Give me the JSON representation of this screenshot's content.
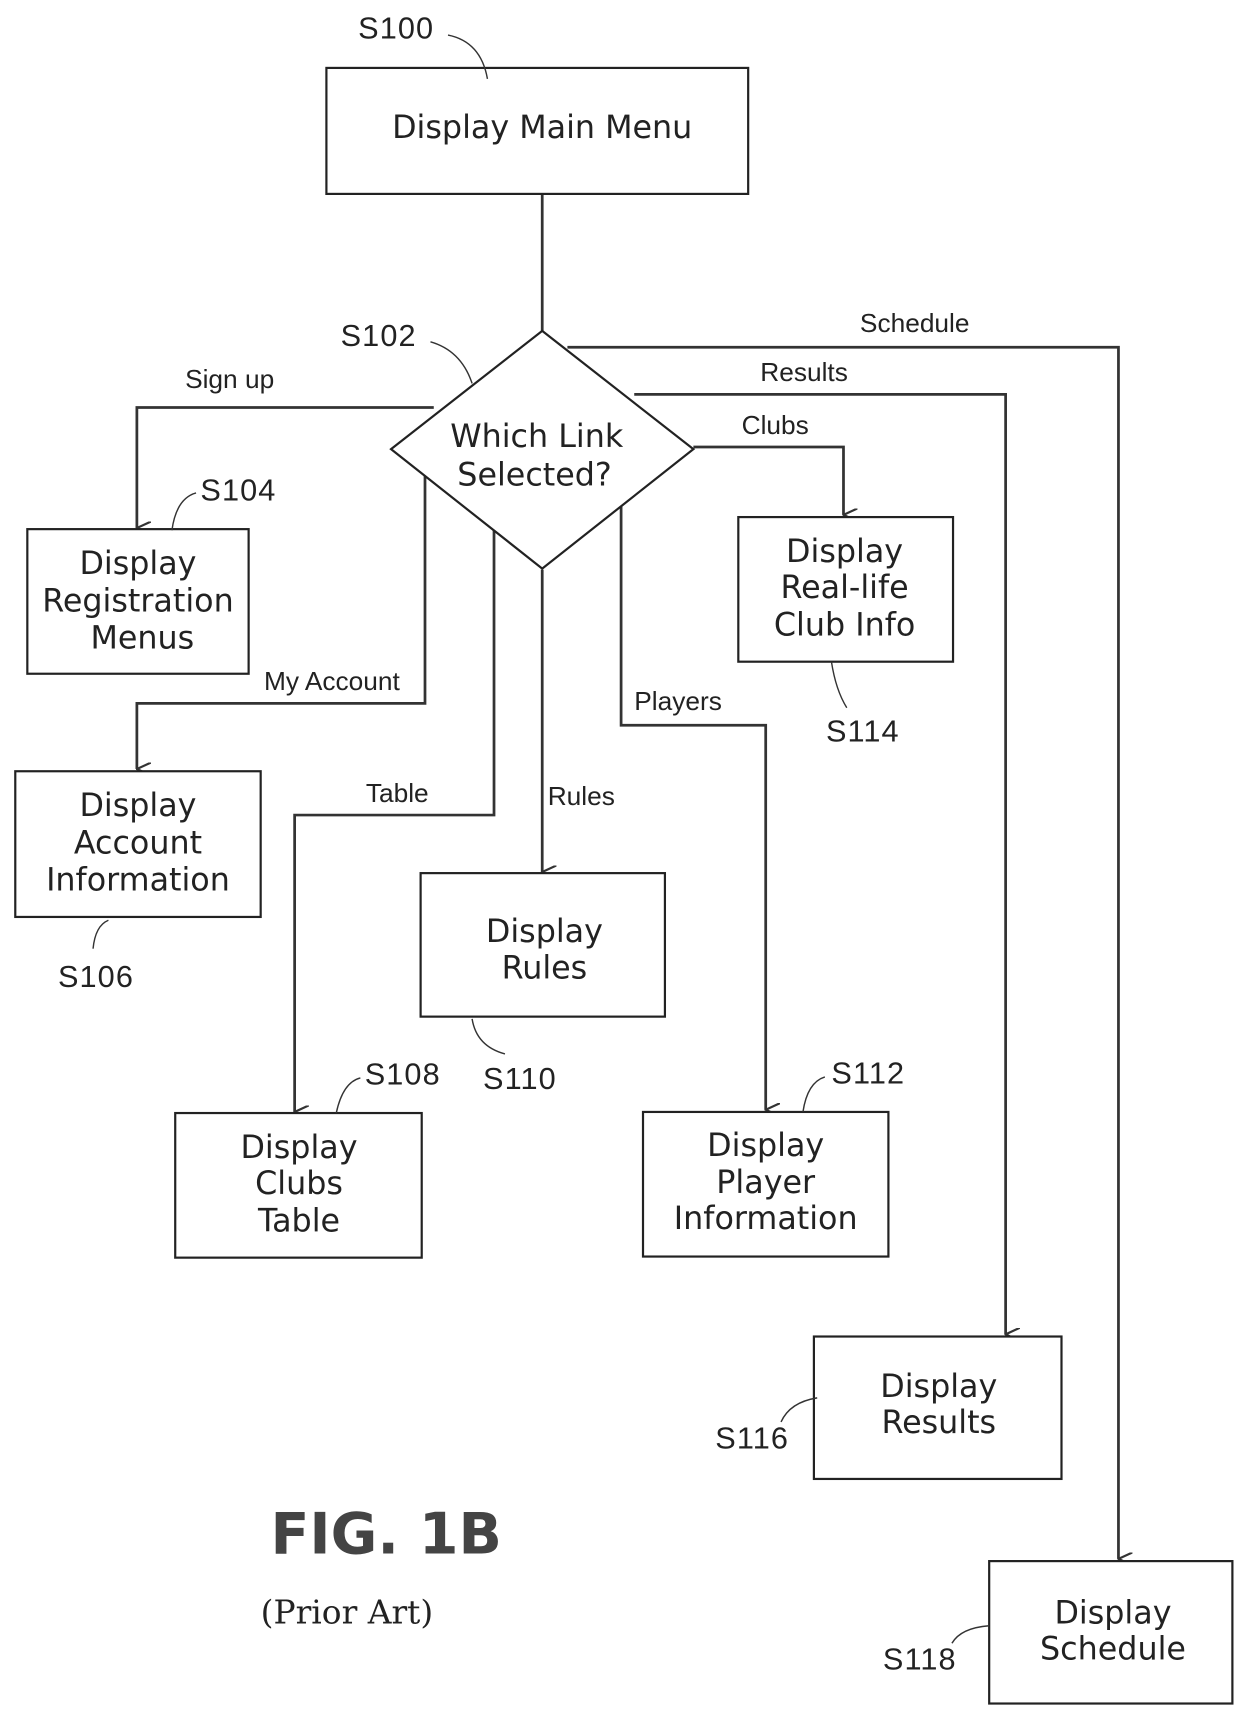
{
  "figure": {
    "title": "FIG. 1B",
    "subtitle": "(Prior Art)"
  },
  "nodes": {
    "s100": {
      "ref": "S100",
      "lines": [
        "Display Main Menu"
      ]
    },
    "s102": {
      "ref": "S102",
      "lines": [
        "Which Link",
        "Selected?"
      ]
    },
    "s104": {
      "ref": "S104",
      "lines": [
        "Display",
        "Registration",
        "Menus"
      ]
    },
    "s106": {
      "ref": "S106",
      "lines": [
        "Display",
        "Account",
        "Information"
      ]
    },
    "s108": {
      "ref": "S108",
      "lines": [
        "Display",
        "Clubs",
        "Table"
      ]
    },
    "s110": {
      "ref": "S110",
      "lines": [
        "Display",
        "Rules"
      ]
    },
    "s112": {
      "ref": "S112",
      "lines": [
        "Display",
        "Player",
        "Information"
      ]
    },
    "s114": {
      "ref": "S114",
      "lines": [
        "Display",
        "Real-life",
        "Club Info"
      ]
    },
    "s116": {
      "ref": "S116",
      "lines": [
        "Display",
        "Results"
      ]
    },
    "s118": {
      "ref": "S118",
      "lines": [
        "Display",
        "Schedule"
      ]
    }
  },
  "edges": {
    "signup": "Sign up",
    "myaccount": "My Account",
    "table": "Table",
    "rules": "Rules",
    "players": "Players",
    "clubs": "Clubs",
    "results": "Results",
    "schedule": "Schedule"
  }
}
